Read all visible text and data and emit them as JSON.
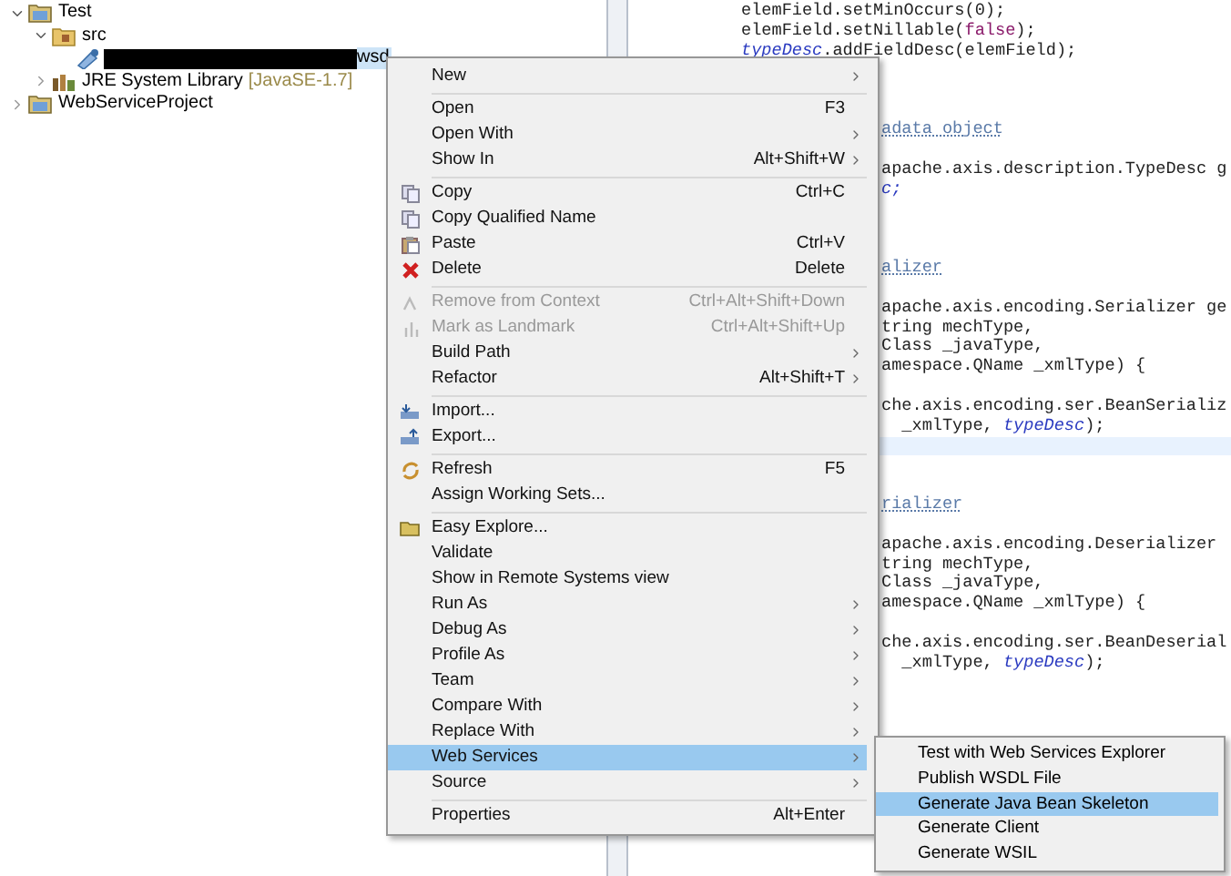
{
  "tree": [
    {
      "label": "Test",
      "expanded": true,
      "children": [
        {
          "label": "src",
          "expanded": true,
          "children": [
            {
              "label": "wsd",
              "kind": "file",
              "selected": true,
              "redacted": true
            }
          ]
        },
        {
          "label": "JRE System Library",
          "suffix": "[JavaSE-1.7]",
          "expanded": false,
          "kind": "library"
        }
      ]
    },
    {
      "label": "WebServiceProject",
      "expanded": false
    }
  ],
  "editor": {
    "lines": [
      {
        "kind": "code",
        "segments": [
          {
            "text": "elemField.setMinOccurs(0);",
            "kind": "plain"
          }
        ]
      },
      {
        "kind": "code",
        "segments": [
          {
            "text": "elemField.setNillable(",
            "kind": "plain"
          },
          {
            "text": "false",
            "kind": "keyword"
          },
          {
            "text": ");",
            "kind": "plain"
          }
        ]
      },
      {
        "kind": "code",
        "segments": [
          {
            "text": "typeDesc",
            "kind": "field"
          },
          {
            "text": ".addFieldDesc(elemField);",
            "kind": "plain"
          }
        ]
      },
      {
        "kind": "blank"
      },
      {
        "kind": "blank"
      },
      {
        "kind": "blank"
      },
      {
        "kind": "partial",
        "segments": [
          {
            "text": "adata object",
            "kind": "comment"
          }
        ]
      },
      {
        "kind": "blank"
      },
      {
        "kind": "partial",
        "segments": [
          {
            "text": "apache.axis.description.TypeDesc g",
            "kind": "plain"
          }
        ]
      },
      {
        "kind": "partial",
        "segments": [
          {
            "text": "c;",
            "kind": "field"
          }
        ]
      },
      {
        "kind": "blank"
      },
      {
        "kind": "blank"
      },
      {
        "kind": "blank"
      },
      {
        "kind": "partial",
        "segments": [
          {
            "text": "alizer",
            "kind": "comment"
          }
        ]
      },
      {
        "kind": "blank"
      },
      {
        "kind": "partial",
        "segments": [
          {
            "text": "apache.axis.encoding.Serializer ge",
            "kind": "plain"
          }
        ]
      },
      {
        "kind": "partial",
        "segments": [
          {
            "text": "tring mechType,",
            "kind": "plain"
          }
        ]
      },
      {
        "kind": "partial",
        "segments": [
          {
            "text": "Class _javaType,",
            "kind": "plain"
          }
        ]
      },
      {
        "kind": "partial",
        "segments": [
          {
            "text": "amespace.QName _xmlType) {",
            "kind": "plain"
          }
        ]
      },
      {
        "kind": "blank"
      },
      {
        "kind": "partial",
        "segments": [
          {
            "text": "che.axis.encoding.ser.BeanSerializ",
            "kind": "plain"
          }
        ]
      },
      {
        "kind": "partial",
        "segments": [
          {
            "text": "  _xmlType, ",
            "kind": "plain"
          },
          {
            "text": "typeDesc",
            "kind": "field"
          },
          {
            "text": ");",
            "kind": "plain"
          }
        ]
      },
      {
        "kind": "current"
      },
      {
        "kind": "blank"
      },
      {
        "kind": "blank"
      },
      {
        "kind": "partial",
        "segments": [
          {
            "text": "rializer",
            "kind": "comment"
          }
        ]
      },
      {
        "kind": "blank"
      },
      {
        "kind": "partial",
        "segments": [
          {
            "text": "apache.axis.encoding.Deserializer",
            "kind": "plain"
          }
        ]
      },
      {
        "kind": "partial",
        "segments": [
          {
            "text": "tring mechType,",
            "kind": "plain"
          }
        ]
      },
      {
        "kind": "partial",
        "segments": [
          {
            "text": "Class _javaType,",
            "kind": "plain"
          }
        ]
      },
      {
        "kind": "partial",
        "segments": [
          {
            "text": "amespace.QName _xmlType) {",
            "kind": "plain"
          }
        ]
      },
      {
        "kind": "blank"
      },
      {
        "kind": "partial",
        "segments": [
          {
            "text": "che.axis.encoding.ser.BeanDeserial",
            "kind": "plain"
          }
        ]
      },
      {
        "kind": "partial",
        "segments": [
          {
            "text": "  _xmlType, ",
            "kind": "plain"
          },
          {
            "text": "typeDesc",
            "kind": "field"
          },
          {
            "text": ");",
            "kind": "plain"
          }
        ]
      }
    ]
  },
  "context_menu": {
    "groups": [
      [
        {
          "label": "New",
          "submenu": true,
          "disabled": false,
          "selected": false
        }
      ],
      [
        {
          "label": "Open",
          "shortcut": "F3",
          "submenu": false,
          "disabled": false,
          "selected": false
        },
        {
          "label": "Open With",
          "submenu": true,
          "disabled": false,
          "selected": false
        },
        {
          "label": "Show In",
          "shortcut": "Alt+Shift+W",
          "submenu": true,
          "disabled": false,
          "selected": false
        }
      ],
      [
        {
          "label": "Copy",
          "shortcut": "Ctrl+C",
          "submenu": false,
          "disabled": false,
          "selected": false
        },
        {
          "label": "Copy Qualified Name",
          "submenu": false,
          "disabled": false,
          "selected": false
        },
        {
          "label": "Paste",
          "shortcut": "Ctrl+V",
          "submenu": false,
          "disabled": false,
          "selected": false
        },
        {
          "label": "Delete",
          "shortcut": "Delete",
          "submenu": false,
          "disabled": false,
          "selected": false
        }
      ],
      [
        {
          "label": "Remove from Context",
          "shortcut": "Ctrl+Alt+Shift+Down",
          "submenu": false,
          "disabled": true,
          "selected": false
        },
        {
          "label": "Mark as Landmark",
          "shortcut": "Ctrl+Alt+Shift+Up",
          "submenu": false,
          "disabled": true,
          "selected": false
        },
        {
          "label": "Build Path",
          "submenu": true,
          "disabled": false,
          "selected": false
        },
        {
          "label": "Refactor",
          "shortcut": "Alt+Shift+T",
          "submenu": true,
          "disabled": false,
          "selected": false
        }
      ],
      [
        {
          "label": "Import...",
          "submenu": false,
          "disabled": false,
          "selected": false
        },
        {
          "label": "Export...",
          "submenu": false,
          "disabled": false,
          "selected": false
        }
      ],
      [
        {
          "label": "Refresh",
          "shortcut": "F5",
          "submenu": false,
          "disabled": false,
          "selected": false
        },
        {
          "label": "Assign Working Sets...",
          "submenu": false,
          "disabled": false,
          "selected": false
        }
      ],
      [
        {
          "label": "Easy Explore...",
          "submenu": false,
          "disabled": false,
          "selected": false
        },
        {
          "label": "Validate",
          "submenu": false,
          "disabled": false,
          "selected": false
        },
        {
          "label": "Show in Remote Systems view",
          "submenu": false,
          "disabled": false,
          "selected": false
        },
        {
          "label": "Run As",
          "submenu": true,
          "disabled": false,
          "selected": false
        },
        {
          "label": "Debug As",
          "submenu": true,
          "disabled": false,
          "selected": false
        },
        {
          "label": "Profile As",
          "submenu": true,
          "disabled": false,
          "selected": false
        },
        {
          "label": "Team",
          "submenu": true,
          "disabled": false,
          "selected": false
        },
        {
          "label": "Compare With",
          "submenu": true,
          "disabled": false,
          "selected": false
        },
        {
          "label": "Replace With",
          "submenu": true,
          "disabled": false,
          "selected": false
        },
        {
          "label": "Web Services",
          "submenu": true,
          "disabled": false,
          "selected": true
        },
        {
          "label": "Source",
          "submenu": true,
          "disabled": false,
          "selected": false
        }
      ],
      [
        {
          "label": "Properties",
          "shortcut": "Alt+Enter",
          "submenu": false,
          "disabled": false,
          "selected": false
        }
      ]
    ]
  },
  "submenu": {
    "items": [
      {
        "label": "Test with Web Services Explorer",
        "selected": false
      },
      {
        "label": "Publish WSDL File",
        "selected": false
      },
      {
        "label": "Generate Java Bean Skeleton",
        "selected": true
      },
      {
        "label": "Generate Client",
        "selected": false
      },
      {
        "label": "Generate WSIL",
        "selected": false
      }
    ]
  }
}
